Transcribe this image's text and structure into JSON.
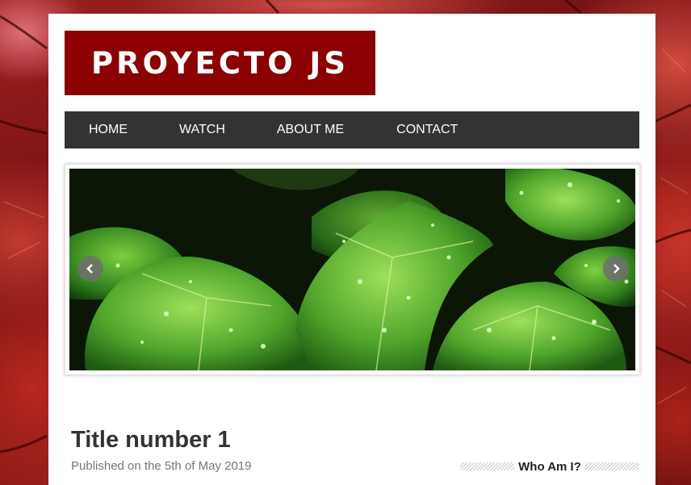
{
  "site": {
    "logo_text": "PROYECTO JS"
  },
  "nav": {
    "items": [
      {
        "label": "HOME"
      },
      {
        "label": "WATCH"
      },
      {
        "label": "ABOUT ME"
      },
      {
        "label": "CONTACT"
      }
    ]
  },
  "slider": {
    "image_subject": "green leaves with water droplets",
    "prev_icon": "chevron-left-icon",
    "next_icon": "chevron-right-icon"
  },
  "post": {
    "title": "Title number 1",
    "meta": "Published on the 5th of May 2019"
  },
  "sidebar": {
    "widget_title": "Who Am I?"
  },
  "colors": {
    "logo_bg": "#8b0000",
    "nav_bg": "#333333",
    "page_bg": "#ffffff",
    "text": "#333333",
    "meta_text": "#777777"
  }
}
